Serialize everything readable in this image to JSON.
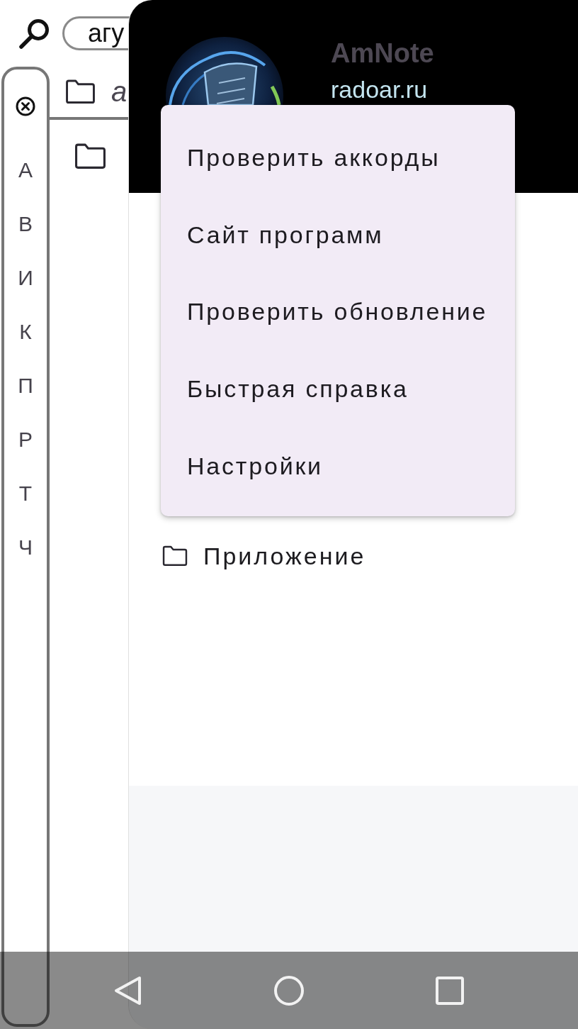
{
  "search": {
    "value": "агу"
  },
  "index_bar": {
    "letters": [
      "А",
      "В",
      "И",
      "К",
      "П",
      "Р",
      "Т",
      "Ч"
    ]
  },
  "list": [
    {
      "kind": "group",
      "title": "а"
    },
    {
      "kind": "folder"
    }
  ],
  "drawer": {
    "header": {
      "app_name": "AmNote",
      "site": "radoar.ru"
    },
    "items": [
      {
        "title": "Приложение"
      }
    ]
  },
  "menu": {
    "items": [
      "Проверить аккорды",
      "Сайт программ",
      "Проверить обновление",
      "Быстрая справка",
      "Настройки"
    ]
  }
}
